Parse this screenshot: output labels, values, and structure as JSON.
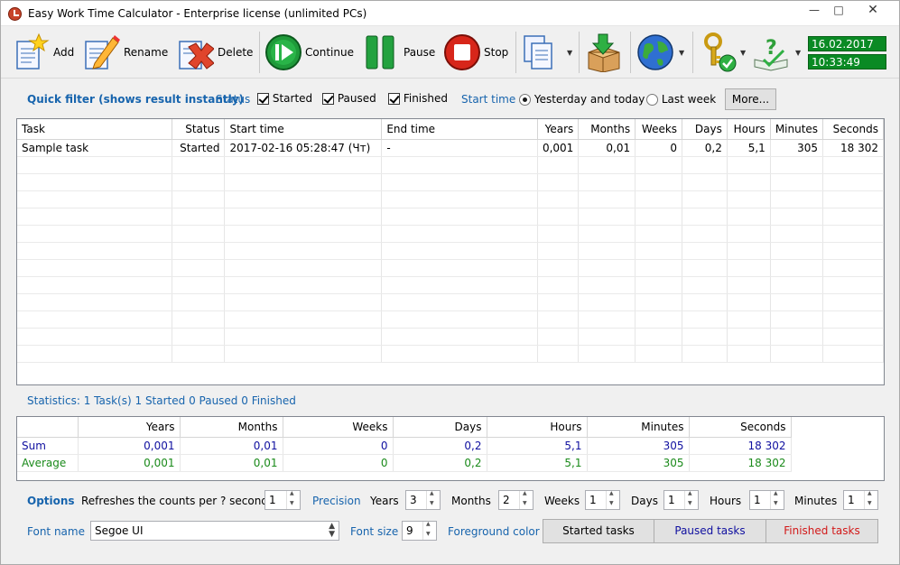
{
  "window": {
    "title": "Easy Work Time Calculator - Enterprise license (unlimited PCs)"
  },
  "toolbar": {
    "add": "Add",
    "rename": "Rename",
    "delete": "Delete",
    "continue": "Continue",
    "pause": "Pause",
    "stop": "Stop",
    "date": "16.02.2017",
    "time": "10:33:49"
  },
  "filter": {
    "title": "Quick filter (shows result instantly)",
    "status_label": "Status",
    "started": "Started",
    "paused": "Paused",
    "finished": "Finished",
    "start_time_label": "Start time",
    "yesterday": "Yesterday and today",
    "last_week": "Last week",
    "more": "More..."
  },
  "tasks": {
    "columns": [
      "Task",
      "Status",
      "Start time",
      "End time",
      "Years",
      "Months",
      "Weeks",
      "Days",
      "Hours",
      "Minutes",
      "Seconds"
    ],
    "rows": [
      [
        "Sample task",
        "Started",
        "2017-02-16 05:28:47 (Чт)",
        "-",
        "0,001",
        "0,01",
        "0",
        "0,2",
        "5,1",
        "305",
        "18 302"
      ]
    ]
  },
  "statistics": {
    "text": "Statistics: 1 Task(s) 1 Started 0 Paused 0 Finished"
  },
  "stats_table": {
    "columns": [
      "",
      "Years",
      "Months",
      "Weeks",
      "Days",
      "Hours",
      "Minutes",
      "Seconds"
    ],
    "sum": [
      "Sum",
      "0,001",
      "0,01",
      "0",
      "0,2",
      "5,1",
      "305",
      "18 302"
    ],
    "average": [
      "Average",
      "0,001",
      "0,01",
      "0",
      "0,2",
      "5,1",
      "305",
      "18 302"
    ],
    "sum_color": "#1010a0",
    "average_color": "#1a8a1a"
  },
  "options": {
    "title": "Options",
    "refresh_label": "Refreshes the counts per ? second(s)",
    "refresh": "1",
    "precision_label": "Precision",
    "years_label": "Years",
    "years": "3",
    "months_label": "Months",
    "months": "2",
    "weeks_label": "Weeks",
    "weeks": "1",
    "days_label": "Days",
    "days": "1",
    "hours_label": "Hours",
    "hours": "1",
    "minutes_label": "Minutes",
    "minutes": "1",
    "font_name_label": "Font name",
    "font_name": "Segoe UI",
    "font_size_label": "Font size",
    "font_size": "9",
    "fg_color_label": "Foreground color",
    "started_tasks": "Started tasks",
    "paused_tasks": "Paused tasks",
    "finished_tasks": "Finished tasks"
  }
}
